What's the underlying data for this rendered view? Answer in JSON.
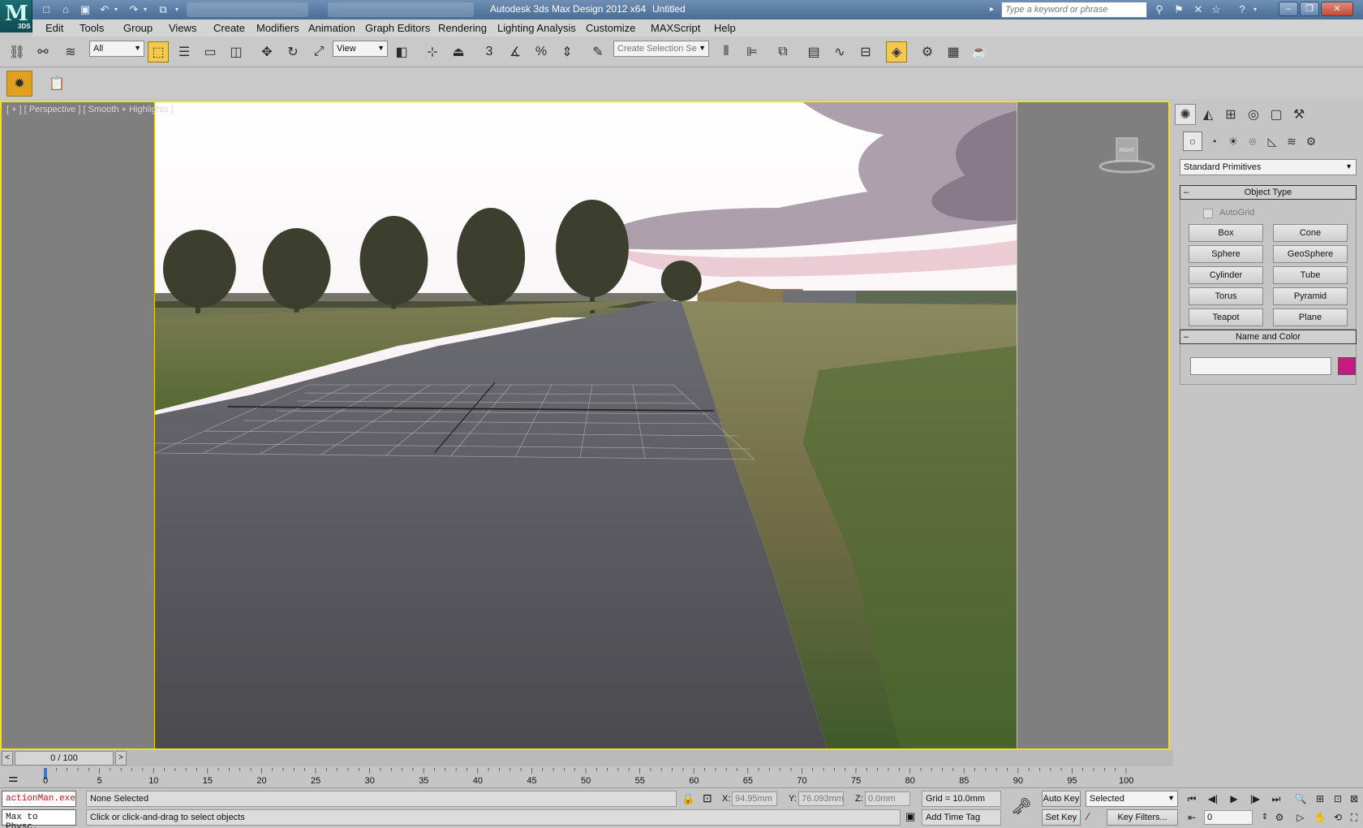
{
  "window": {
    "title": "Autodesk 3ds Max Design 2012 x64",
    "document": "Untitled",
    "logo_text": "3DS",
    "search_placeholder": "Type a keyword or phrase"
  },
  "menu": [
    "Edit",
    "Tools",
    "Group",
    "Views",
    "Create",
    "Modifiers",
    "Animation",
    "Graph Editors",
    "Rendering",
    "Lighting Analysis",
    "Customize",
    "MAXScript",
    "Help"
  ],
  "toolbar": {
    "selection_filter": "All",
    "ref_coord": "View",
    "named_selection_placeholder": "Create Selection Se",
    "snap_label": "3"
  },
  "viewport": {
    "label": "[ + ] [ Perspective ] [ Smooth + Highlights ]",
    "viewcube_label": "RIGHT"
  },
  "command_panel": {
    "category": "Standard Primitives",
    "object_type_title": "Object Type",
    "autogrid_label": "AutoGrid",
    "primitives": [
      "Box",
      "Cone",
      "Sphere",
      "GeoSphere",
      "Cylinder",
      "Tube",
      "Torus",
      "Pyramid",
      "Teapot",
      "Plane"
    ],
    "name_color_title": "Name and Color",
    "object_color": "#c41b82"
  },
  "timeline": {
    "frame_display": "0 / 100",
    "ticks": [
      "0",
      "5",
      "10",
      "15",
      "20",
      "25",
      "30",
      "35",
      "40",
      "45",
      "50",
      "55",
      "60",
      "65",
      "70",
      "75",
      "80",
      "85",
      "90",
      "95",
      "100"
    ]
  },
  "status": {
    "listener_line1": "actionMan.exe",
    "listener_line2": "Max to Physc.",
    "selection": "None Selected",
    "prompt": "Click or click-and-drag to select objects",
    "x_label": "X:",
    "x_value": "94.95mm",
    "y_label": "Y:",
    "y_value": "76.093mm",
    "z_label": "Z:",
    "z_value": "0.0mm",
    "grid": "Grid = 10.0mm",
    "add_time_tag": "Add Time Tag",
    "auto_key": "Auto Key",
    "set_key": "Set Key",
    "key_mode": "Selected",
    "key_filters": "Key Filters...",
    "current_frame": "0"
  }
}
